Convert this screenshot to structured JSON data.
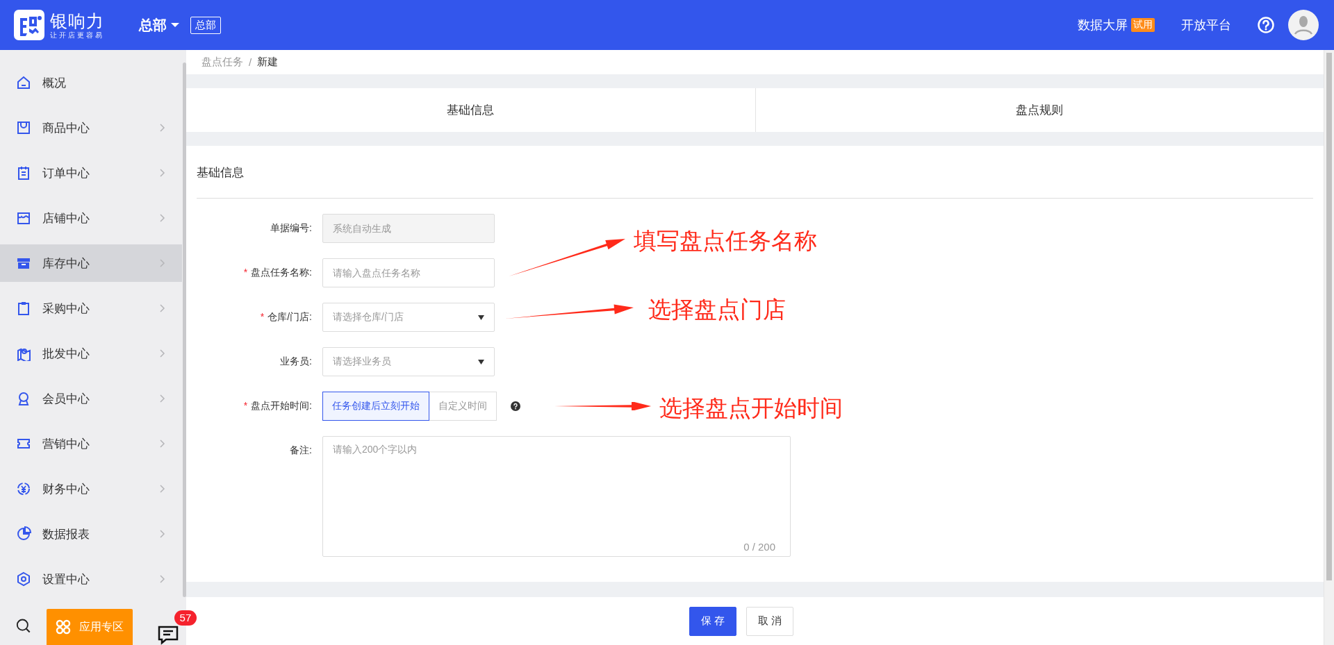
{
  "header": {
    "logo_name": "银响力",
    "logo_tagline": "让开店更容易",
    "org_menu": "总部",
    "org_tag": "总部",
    "links": [
      {
        "label": "数据大屏",
        "badge": "试用"
      },
      {
        "label": "开放平台"
      }
    ]
  },
  "sidebar": {
    "items": [
      {
        "label": "概况",
        "has_children": false,
        "selected": false
      },
      {
        "label": "商品中心",
        "has_children": true,
        "selected": false
      },
      {
        "label": "订单中心",
        "has_children": true,
        "selected": false
      },
      {
        "label": "店铺中心",
        "has_children": true,
        "selected": false
      },
      {
        "label": "库存中心",
        "has_children": true,
        "selected": true
      },
      {
        "label": "采购中心",
        "has_children": true,
        "selected": false
      },
      {
        "label": "批发中心",
        "has_children": true,
        "selected": false
      },
      {
        "label": "会员中心",
        "has_children": true,
        "selected": false
      },
      {
        "label": "营销中心",
        "has_children": true,
        "selected": false
      },
      {
        "label": "财务中心",
        "has_children": true,
        "selected": false
      },
      {
        "label": "数据报表",
        "has_children": true,
        "selected": false
      },
      {
        "label": "设置中心",
        "has_children": true,
        "selected": false
      }
    ],
    "app_zone_button": "应用专区",
    "message_count": "57"
  },
  "breadcrumb": {
    "items": [
      "盘点任务",
      "新建"
    ],
    "separator": "/"
  },
  "tabs": [
    {
      "label": "基础信息"
    },
    {
      "label": "盘点规则"
    }
  ],
  "form": {
    "section_title": "基础信息",
    "fields": [
      {
        "kind": "readonly",
        "label": "单据编号:",
        "placeholder": "系统自动生成"
      },
      {
        "kind": "text",
        "label": "盘点任务名称:",
        "required_mark": "*",
        "placeholder": "请输入盘点任务名称",
        "annotation": "填写盘点任务名称"
      },
      {
        "kind": "select",
        "label": "仓库/门店:",
        "required_mark": "*",
        "placeholder": "请选择仓库/门店",
        "annotation": "选择盘点门店"
      },
      {
        "kind": "select",
        "label": "业务员:",
        "placeholder": "请选择业务员"
      },
      {
        "kind": "segmented",
        "label": "盘点开始时间:",
        "required_mark": "*",
        "help": true,
        "options": [
          {
            "label": "任务创建后立刻开始",
            "selected": true
          },
          {
            "label": "自定义时间",
            "selected": false
          }
        ],
        "annotation": "选择盘点开始时间"
      },
      {
        "kind": "textarea",
        "label": "备注:",
        "placeholder": "请输入200个字以内",
        "counter": "0 / 200"
      }
    ]
  },
  "footer": {
    "buttons": [
      {
        "label": "保存",
        "kind": "primary"
      },
      {
        "label": "取消",
        "kind": "default"
      }
    ]
  }
}
